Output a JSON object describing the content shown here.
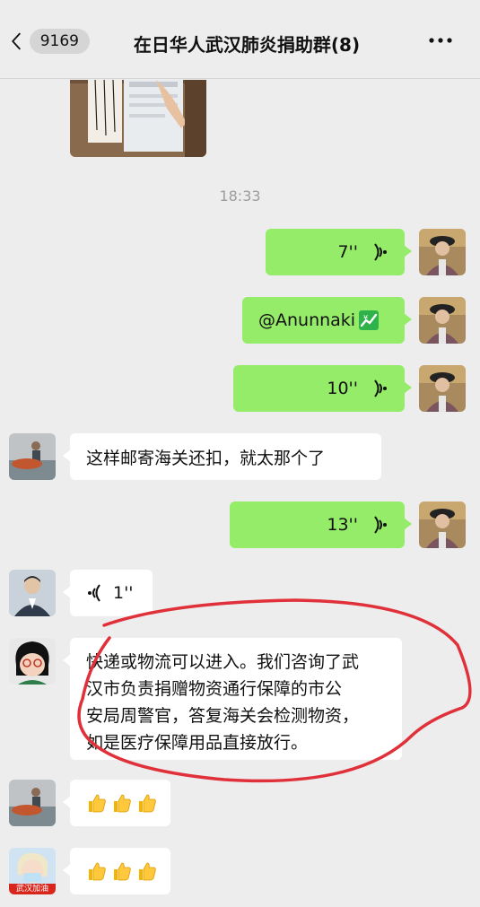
{
  "header": {
    "unread_count": "9169",
    "title": "在日华人武汉肺炎捐助群(8)"
  },
  "timestamp": "18:33",
  "messages": [
    {
      "side": "out",
      "type": "voice",
      "duration": "7''"
    },
    {
      "side": "out",
      "type": "text",
      "text": "@Anunnaki"
    },
    {
      "side": "out",
      "type": "voice",
      "duration": "10''"
    },
    {
      "side": "in",
      "type": "text",
      "text": "这样邮寄海关还扣，就太那个了"
    },
    {
      "side": "out",
      "type": "voice",
      "duration": "13''"
    },
    {
      "side": "in",
      "type": "voice",
      "duration": "1''"
    },
    {
      "side": "in",
      "type": "text",
      "lines": [
        "快递或物流可以进入。我们咨询了武",
        "汉市负责捐赠物资通行保障的市公",
        "安局周警官，答复海关会检测物资，",
        "如是医疗保障用品直接放行。"
      ]
    },
    {
      "side": "in",
      "type": "emoji",
      "emoji": "thumbs-up x3"
    },
    {
      "side": "in",
      "type": "emoji",
      "emoji": "thumbs-up x3"
    }
  ],
  "avatar_labels": {
    "last_sender_badge": "武汉加油"
  },
  "colors": {
    "outgoing_bubble": "#95ec69",
    "incoming_bubble": "#ffffff",
    "background": "#ededed",
    "annotation_circle": "#e0313a"
  }
}
